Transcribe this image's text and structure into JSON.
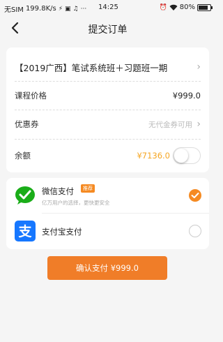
{
  "status_bar": {
    "carrier": "无SIM",
    "speed": "199.8K/s",
    "time": "14:25",
    "battery": "80%",
    "left_icons": [
      "usb-icon",
      "notification-icon",
      "music-icon",
      "more-icon"
    ],
    "right_icons": [
      "alarm-icon",
      "wifi-icon",
      "battery-icon"
    ]
  },
  "nav": {
    "title": "提交订单",
    "back_icon": "back-arrow-icon"
  },
  "order": {
    "course_title": "【2019广西】笔试系统班＋习题班一期",
    "price_label": "课程价格",
    "price_value": "¥999.0",
    "coupon_label": "优惠券",
    "coupon_value": "无代金券可用",
    "balance_label": "余额",
    "balance_value": "¥7136.0",
    "balance_toggle_on": false
  },
  "payment": {
    "wechat_name": "微信支付",
    "wechat_badge": "推荐",
    "wechat_desc": "亿万用户的选择，更快更安全",
    "wechat_selected": true,
    "alipay_name": "支付宝支付",
    "alipay_selected": false
  },
  "confirm_button": "确认支付 ¥999.0",
  "colors": {
    "accent": "#f07d28",
    "balance": "#f5a623",
    "wechat_green": "#1aad19",
    "alipay_blue": "#1677ff"
  }
}
